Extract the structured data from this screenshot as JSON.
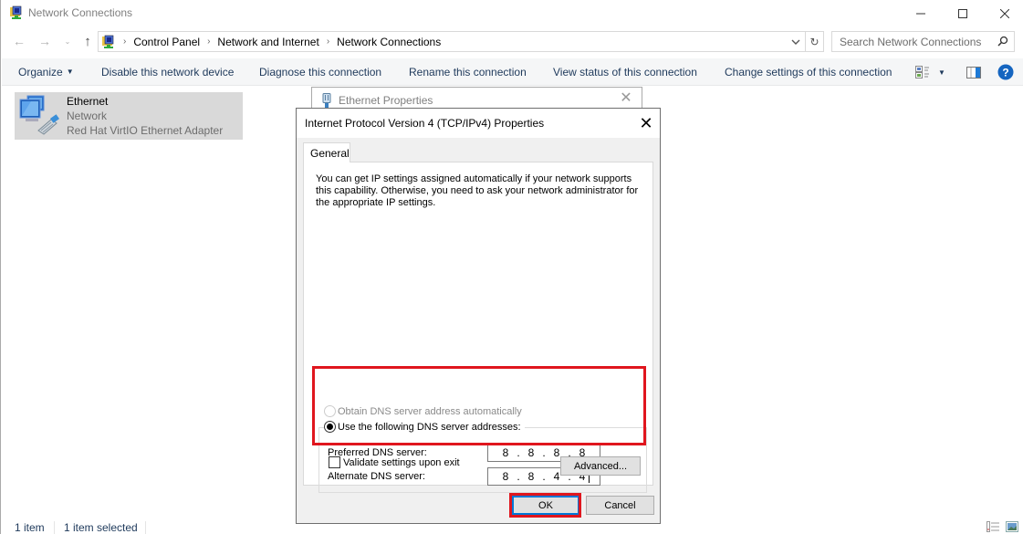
{
  "window": {
    "title": "Network Connections",
    "controls": {
      "minimize": "—",
      "maximize": "☐",
      "close": "✕"
    }
  },
  "navigation": {
    "back_icon": "←",
    "forward_icon": "→",
    "recent_icon": "⌄",
    "up_icon": "↑",
    "breadcrumbs": [
      "Control Panel",
      "Network and Internet",
      "Network Connections"
    ],
    "breadcrumb_sep": "›",
    "dropdown_icon": "⌄",
    "refresh_icon": "↻",
    "search_placeholder": "Search Network Connections"
  },
  "commandbar": {
    "organize": "Organize",
    "organize_caret": "▼",
    "disable": "Disable this network device",
    "diagnose": "Diagnose this connection",
    "rename": "Rename this connection",
    "view_status": "View status of this connection",
    "change_settings": "Change settings of this connection",
    "view_caret": "▼",
    "help": "?"
  },
  "items": [
    {
      "name": "Ethernet",
      "status": "Network",
      "adapter": "Red Hat VirtIO Ethernet Adapter"
    }
  ],
  "statusbar": {
    "count": "1 item",
    "selected": "1 item selected"
  },
  "ethernet_properties": {
    "title": "Ethernet Properties",
    "close": "✕"
  },
  "ipv4_dialog": {
    "title": "Internet Protocol Version 4 (TCP/IPv4) Properties",
    "close": "✕",
    "tab": "General",
    "description": "You can get IP settings assigned automatically if your network supports this capability. Otherwise, you need to ask your network administrator for the appropriate IP settings.",
    "dns_auto_label": "Obtain DNS server address automatically",
    "dns_auto_selected": false,
    "dns_auto_enabled": false,
    "dns_manual_label": "Use the following DNS server addresses:",
    "dns_manual_selected": true,
    "preferred_label": "Preferred DNS server:",
    "preferred_octets": [
      "8",
      "8",
      "8",
      "8"
    ],
    "alternate_label": "Alternate DNS server:",
    "alternate_octets": [
      "8",
      "8",
      "4",
      "4"
    ],
    "octet_sep": ".",
    "validate_label": "Validate settings upon exit",
    "validate_checked": false,
    "advanced_label": "Advanced...",
    "ok_label": "OK",
    "cancel_label": "Cancel"
  },
  "colors": {
    "highlight": "#e0161e",
    "focus_blue": "#0078d7",
    "link_text": "#1e395b",
    "help_blue": "#1565c0",
    "selected_item_bg": "#d9d9d9"
  }
}
